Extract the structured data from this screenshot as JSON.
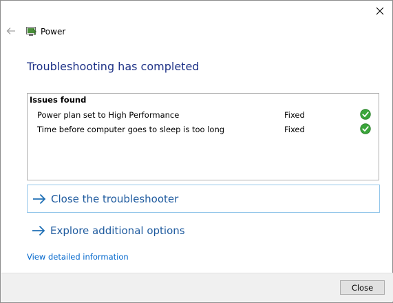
{
  "window": {
    "app_title": "Power",
    "heading": "Troubleshooting has completed"
  },
  "issues": {
    "header": "Issues found",
    "rows": [
      {
        "description": "Power plan set to High Performance",
        "status": "Fixed"
      },
      {
        "description": "Time before computer goes to sleep is too long",
        "status": "Fixed"
      }
    ]
  },
  "actions": {
    "close_troubleshooter": "Close the troubleshooter",
    "explore_options": "Explore additional options",
    "view_details": "View detailed information"
  },
  "footer": {
    "close_label": "Close"
  },
  "icons": {
    "close": "close-icon",
    "back": "back-arrow-icon",
    "app": "power-troubleshooter-icon",
    "status": "check-circle-icon",
    "command": "right-arrow-icon"
  },
  "colors": {
    "heading": "#1e3287",
    "link": "#0066cc",
    "command_text": "#1e5a9e",
    "check_green": "#3aa53a",
    "selected_border": "#93c6ea"
  }
}
